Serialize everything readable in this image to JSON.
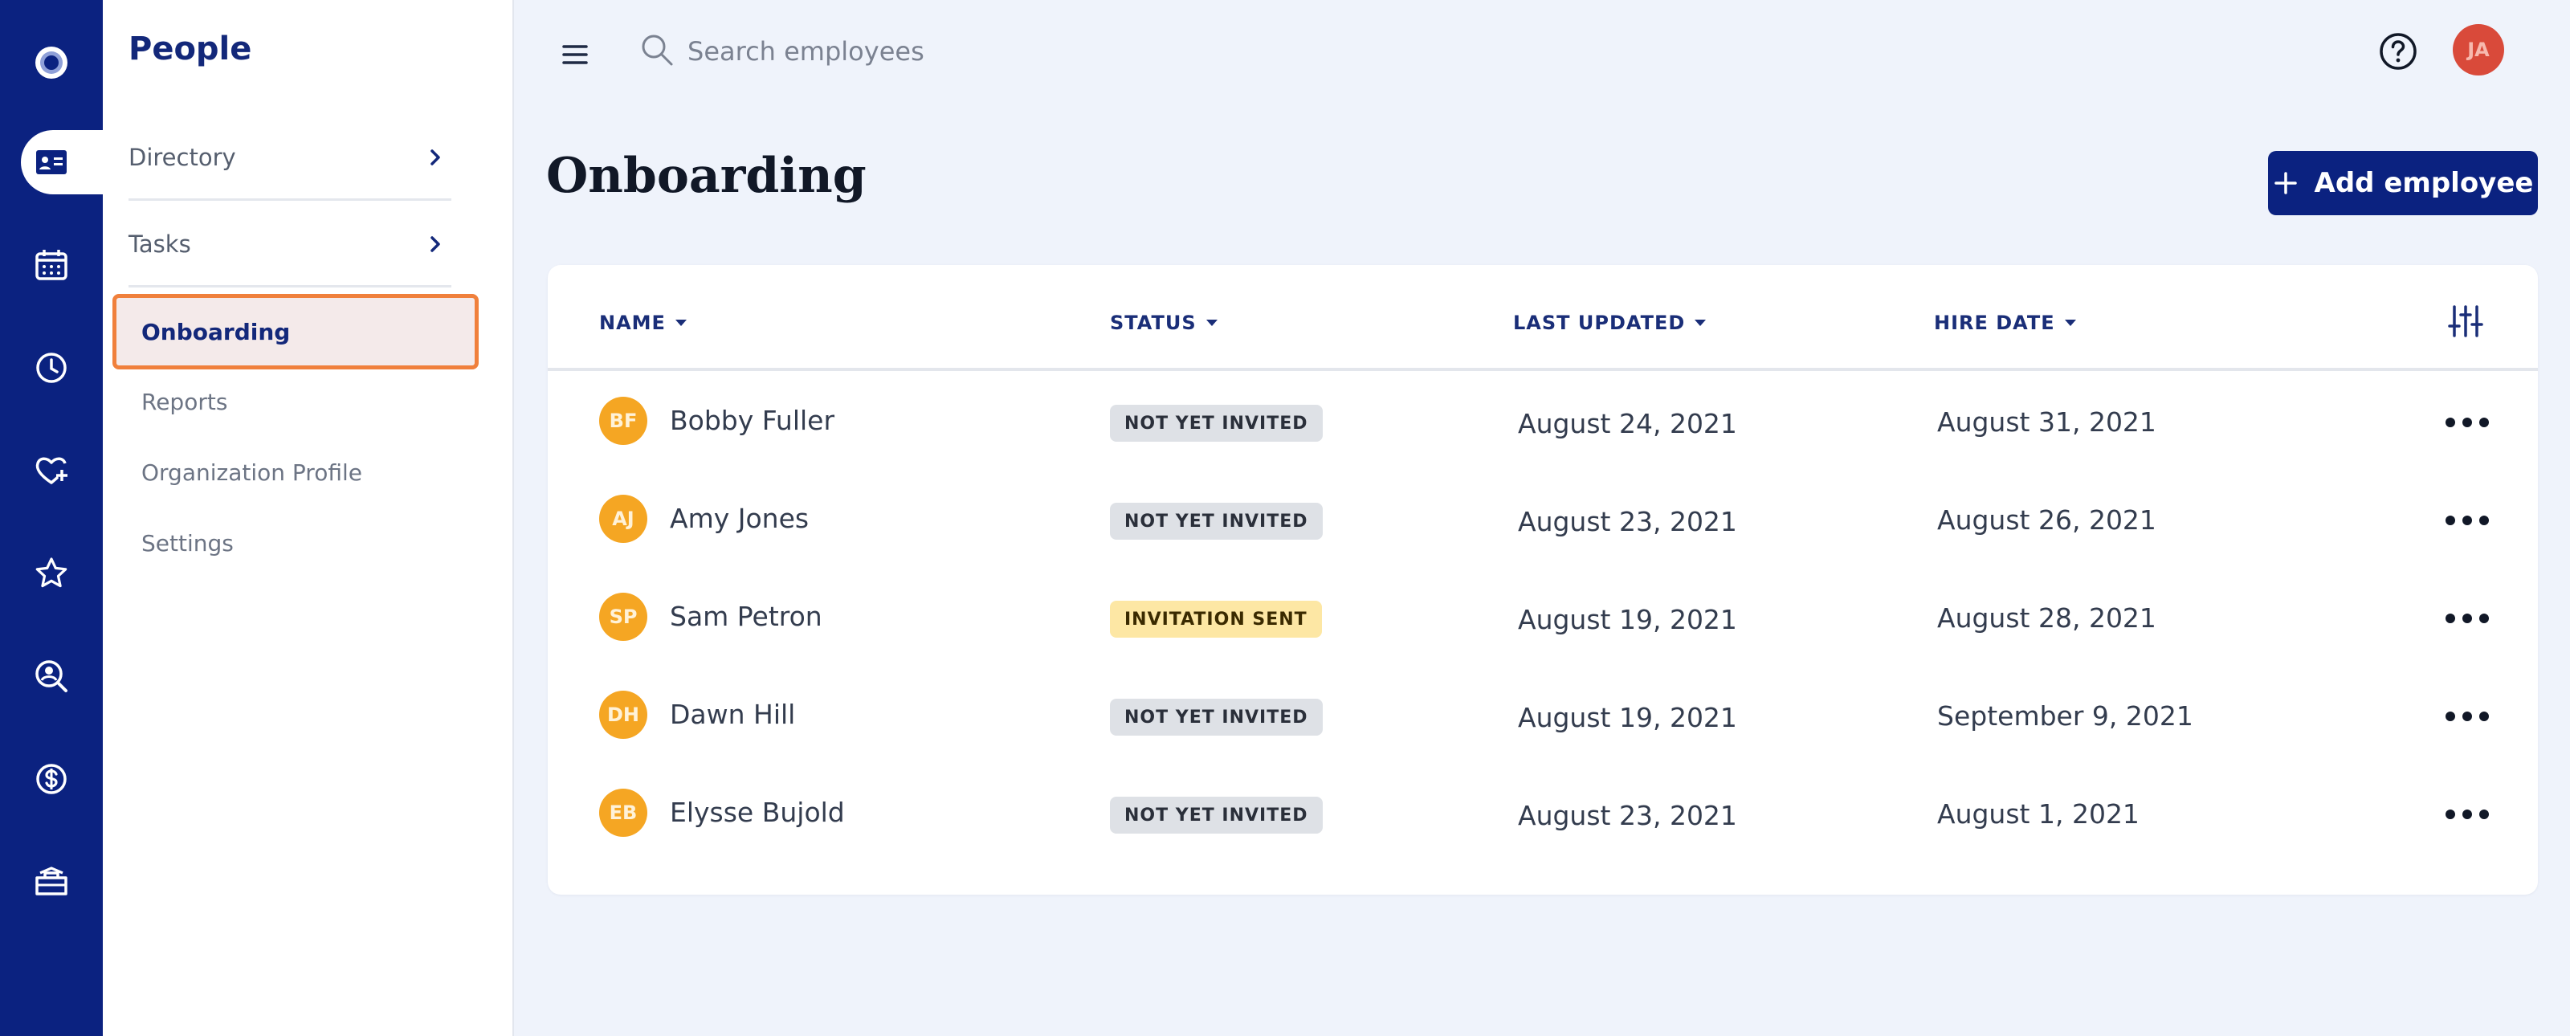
{
  "rail": {
    "items": [
      {
        "icon": "logo-icon"
      },
      {
        "icon": "id-card-icon",
        "active": true
      },
      {
        "icon": "calendar-icon"
      },
      {
        "icon": "clock-icon"
      },
      {
        "icon": "heart-plus-icon"
      },
      {
        "icon": "star-icon"
      },
      {
        "icon": "search-person-icon"
      },
      {
        "icon": "dollar-icon"
      },
      {
        "icon": "toolbox-icon"
      }
    ]
  },
  "subnav": {
    "title": "People",
    "groups": [
      {
        "label": "Directory"
      },
      {
        "label": "Tasks"
      }
    ],
    "items": [
      {
        "label": "Onboarding",
        "active": true
      },
      {
        "label": "Reports"
      },
      {
        "label": "Organization Profile"
      },
      {
        "label": "Settings"
      }
    ]
  },
  "topbar": {
    "search_placeholder": "Search employees",
    "user_initials": "JA"
  },
  "main": {
    "title": "Onboarding",
    "add_button_label": "Add employee"
  },
  "table": {
    "columns": [
      "NAME",
      "STATUS",
      "LAST UPDATED",
      "HIRE DATE"
    ],
    "rows": [
      {
        "initials": "BF",
        "name": "Bobby Fuller",
        "status": "NOT YET INVITED",
        "last_updated": "August 24, 2021",
        "hire_date": "August 31, 2021"
      },
      {
        "initials": "AJ",
        "name": "Amy Jones",
        "status": "NOT YET INVITED",
        "last_updated": "August 23, 2021",
        "hire_date": "August 26, 2021"
      },
      {
        "initials": "SP",
        "name": "Sam Petron",
        "status": "INVITATION SENT",
        "last_updated": "August 19, 2021",
        "hire_date": "August 28, 2021"
      },
      {
        "initials": "DH",
        "name": "Dawn Hill",
        "status": "NOT YET INVITED",
        "last_updated": "August 19, 2021",
        "hire_date": "September 9, 2021"
      },
      {
        "initials": "EB",
        "name": "Elysse Bujold",
        "status": "NOT YET INVITED",
        "last_updated": "August 23, 2021",
        "hire_date": "August 1, 2021"
      }
    ]
  },
  "colors": {
    "brand_navy": "#0b2280",
    "highlight_orange": "#f0803c",
    "avatar_orange": "#f5a623",
    "user_avatar_red": "#d94a3a",
    "badge_gray": "#dee1e6",
    "badge_yellow": "#fde7a4"
  }
}
